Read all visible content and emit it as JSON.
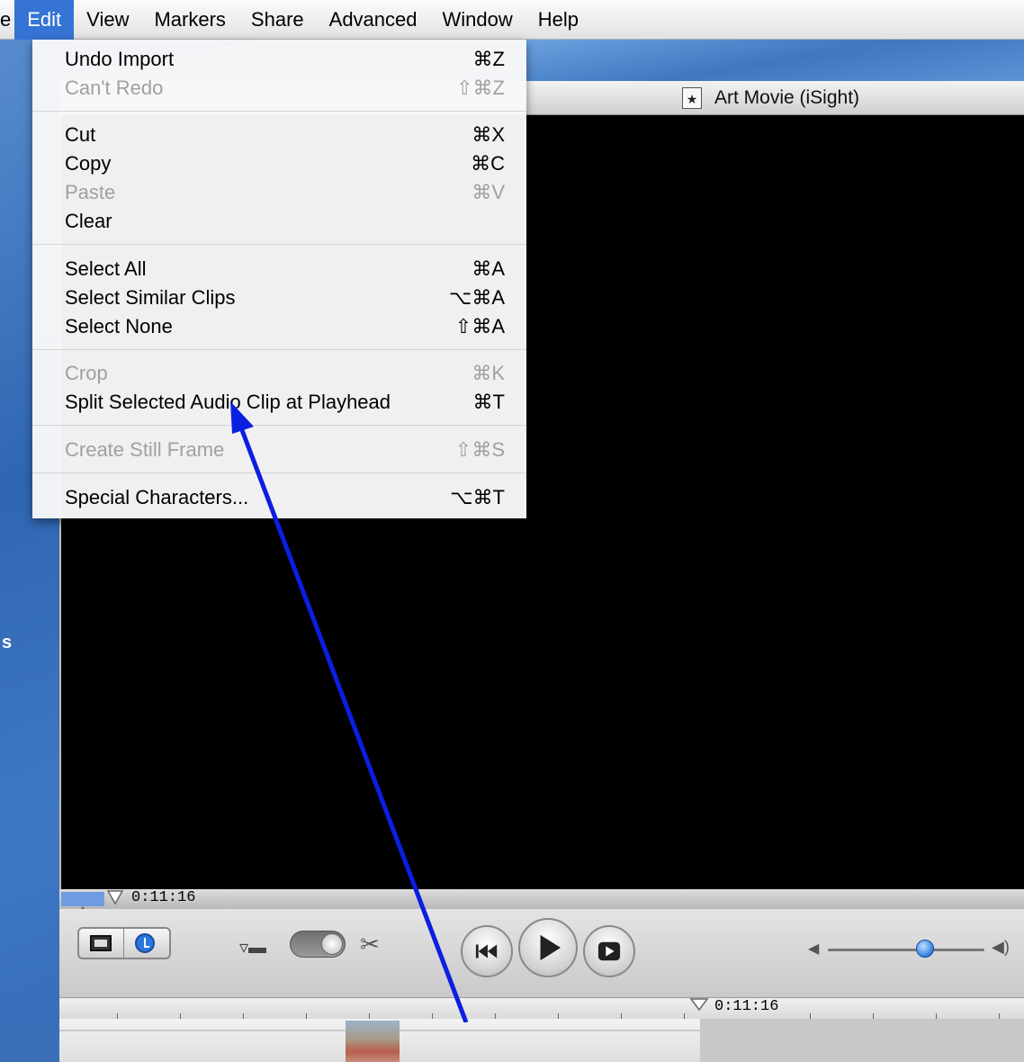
{
  "menubar": {
    "items": [
      "e",
      "Edit",
      "View",
      "Markers",
      "Share",
      "Advanced",
      "Window",
      "Help"
    ]
  },
  "desktop": {
    "text": "s"
  },
  "window": {
    "title": "Art Movie (iSight)",
    "scrubber_time": "0:11:16",
    "ruler_time": "0:11:16",
    "volume_level": 0.62
  },
  "edit_menu": {
    "items": [
      {
        "label": "Undo Import",
        "shortcut": "⌘Z",
        "enabled": true
      },
      {
        "label": "Can't Redo",
        "shortcut": "⇧⌘Z",
        "enabled": false
      },
      {
        "label": "Cut",
        "shortcut": "⌘X",
        "enabled": true
      },
      {
        "label": "Copy",
        "shortcut": "⌘C",
        "enabled": true
      },
      {
        "label": "Paste",
        "shortcut": "⌘V",
        "enabled": false
      },
      {
        "label": "Clear",
        "shortcut": "",
        "enabled": true
      },
      {
        "label": "Select All",
        "shortcut": "⌘A",
        "enabled": true
      },
      {
        "label": "Select Similar Clips",
        "shortcut": "⌥⌘A",
        "enabled": true
      },
      {
        "label": "Select None",
        "shortcut": "⇧⌘A",
        "enabled": true
      },
      {
        "label": "Crop",
        "shortcut": "⌘K",
        "enabled": false
      },
      {
        "label": "Split Selected Audio Clip at Playhead",
        "shortcut": "⌘T",
        "enabled": true
      },
      {
        "label": "Create Still Frame",
        "shortcut": "⇧⌘S",
        "enabled": false
      },
      {
        "label": "Special Characters...",
        "shortcut": "⌥⌘T",
        "enabled": true
      }
    ]
  },
  "colors": {
    "menu_highlight": "#3573d5",
    "annotation_arrow": "#0a1fe0",
    "volume_knob": "#2f7fe0"
  }
}
